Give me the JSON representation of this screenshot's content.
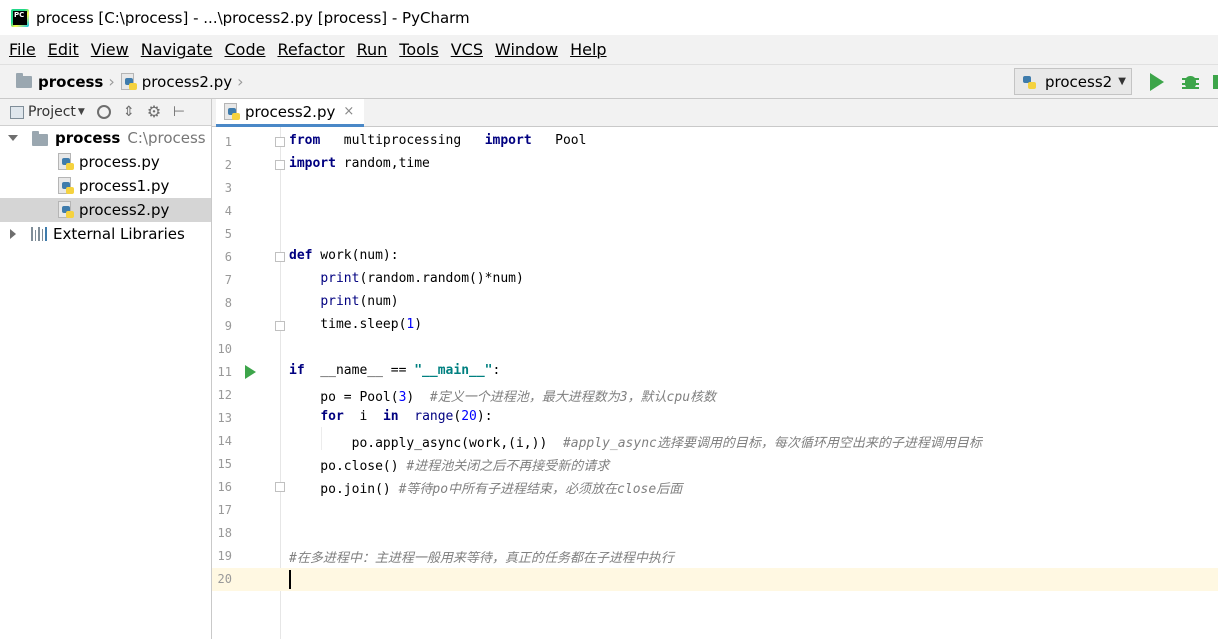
{
  "window": {
    "title": "process [C:\\process] - ...\\process2.py [process] - PyCharm"
  },
  "menu": [
    "File",
    "Edit",
    "View",
    "Navigate",
    "Code",
    "Refactor",
    "Run",
    "Tools",
    "VCS",
    "Window",
    "Help"
  ],
  "breadcrumb": {
    "project": "process",
    "file": "process2.py"
  },
  "run_config": {
    "label": "process2"
  },
  "project_panel": {
    "title": "Project",
    "root": {
      "name": "process",
      "path": "C:\\process"
    },
    "files": [
      "process.py",
      "process1.py",
      "process2.py"
    ],
    "selected_file": "process2.py",
    "external": "External Libraries"
  },
  "editor": {
    "tab_label": "process2.py",
    "tab_close": "×",
    "line_numbers": [
      "1",
      "2",
      "3",
      "4",
      "5",
      "6",
      "7",
      "8",
      "9",
      "10",
      "11",
      "12",
      "13",
      "14",
      "15",
      "16",
      "17",
      "18",
      "19",
      "20"
    ],
    "current_line": 20
  },
  "colors": {
    "keyword": "#000080",
    "number": "#0000ff",
    "string": "#008080",
    "comment": "#808080",
    "run": "#3da54a",
    "current_line": "#fff8e2"
  },
  "icons": [
    "pycharm-app-icon",
    "folder-icon",
    "python-file-icon",
    "run-icon",
    "debug-icon",
    "library-icon"
  ]
}
